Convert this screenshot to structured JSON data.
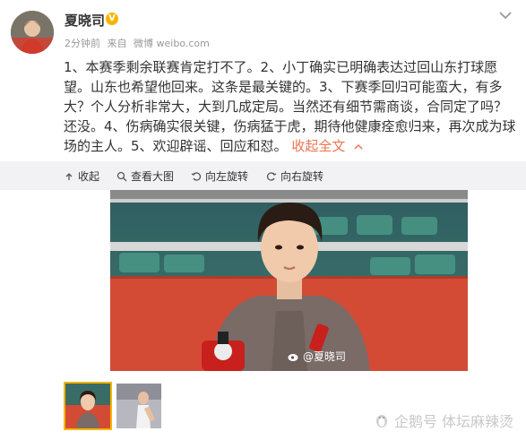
{
  "post": {
    "username": "夏晓司",
    "verified_icon": "verified-badge-icon",
    "time": "2分钟前",
    "source_prefix": "来自",
    "source": "微博 weibo.com",
    "text": "1、本赛季剩余联赛肯定打不了。2、小丁确实已明确表达过回山东打球愿望。山东也希望他回来。这条是最关键的。3、下赛季回归可能蛮大，有多大？个人分析非常大，大到几成定局。当然还有细节需商谈，合同定了吗？还没。4、伤病确实很关键，伤病猛于虎，期待他健康痊愈归来，再次成为球场的主人。5、欢迎辟谣、回应和怼。",
    "collapse_label": "收起全文",
    "collapse_icon": "chevron-up-icon"
  },
  "toolbar": {
    "items": [
      {
        "label": "收起",
        "icon": "collapse-up-icon"
      },
      {
        "label": "查看大图",
        "icon": "search-icon"
      },
      {
        "label": "向左旋转",
        "icon": "rotate-left-icon"
      },
      {
        "label": "向右旋转",
        "icon": "rotate-right-icon"
      }
    ]
  },
  "image": {
    "watermark": "@夏晓司"
  },
  "footer": {
    "brand": "企鹅号 体坛麻辣烫"
  },
  "colors": {
    "accent": "#eb7350",
    "toolbar_bg": "#f2f2f5",
    "verified": "#f7b500"
  }
}
